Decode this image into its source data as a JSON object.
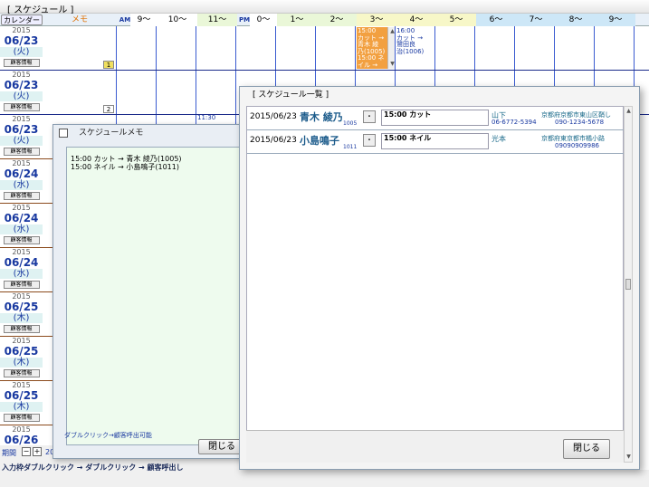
{
  "window_title": "[ スケジュール ]",
  "header": {
    "calendar_button": "カレンダー",
    "memo": "メモ",
    "am": "AM",
    "pm": "PM",
    "hours": [
      {
        "label": "9〜",
        "color": "#ffffff"
      },
      {
        "label": "10〜",
        "color": "#ffffff"
      },
      {
        "label": "11〜",
        "color": "#eaf7d8"
      },
      {
        "label": "0〜",
        "color": "#ffffff"
      },
      {
        "label": "1〜",
        "color": "#eaf7d8"
      },
      {
        "label": "2〜",
        "color": "#eaf7d8"
      },
      {
        "label": "3〜",
        "color": "#f7f7c8"
      },
      {
        "label": "4〜",
        "color": "#f7f7c8"
      },
      {
        "label": "5〜",
        "color": "#f7f7c8"
      },
      {
        "label": "6〜",
        "color": "#cde7f7"
      },
      {
        "label": "7〜",
        "color": "#cde7f7"
      },
      {
        "label": "8〜",
        "color": "#cde7f7"
      },
      {
        "label": "9〜",
        "color": "#cde7f7"
      }
    ]
  },
  "days": [
    {
      "year": "2015",
      "md": "06/23",
      "wd": "(火)",
      "sb": "顧客情報",
      "badge": "1"
    },
    {
      "year": "2015",
      "md": "06/23",
      "wd": "(火)",
      "sb": "顧客情報",
      "badge": "2"
    },
    {
      "year": "2015",
      "md": "06/23",
      "wd": "(火)",
      "sb": "顧客情報"
    },
    {
      "year": "2015",
      "md": "06/24",
      "wd": "(水)",
      "sb": "顧客情報"
    },
    {
      "year": "2015",
      "md": "06/24",
      "wd": "(水)",
      "sb": "顧客情報"
    },
    {
      "year": "2015",
      "md": "06/24",
      "wd": "(水)",
      "sb": "顧客情報"
    },
    {
      "year": "2015",
      "md": "06/25",
      "wd": "(木)",
      "sb": "顧客情報"
    },
    {
      "year": "2015",
      "md": "06/25",
      "wd": "(木)",
      "sb": "顧客情報"
    },
    {
      "year": "2015",
      "md": "06/25",
      "wd": "(木)",
      "sb": "顧客情報"
    },
    {
      "year": "2015",
      "md": "06/26",
      "wd": "",
      "sb": ""
    }
  ],
  "grid_appts": {
    "a1": "15:00\nカット →\n青木 綾\n乃(1005)\n15:00 ネ\nイル →",
    "a2": "16:00\nカット →\n鷲田良\n治(1006)",
    "time_label": "11:30"
  },
  "bottom": {
    "period_label": "期間",
    "hint": "入力枠ダブルクリック → ダブルクリック → 顧客呼出し",
    "partial": "20"
  },
  "memo_window": {
    "title": "スケジュールメモ",
    "lines": [
      "15:00 カット → 青木 綾乃(1005)",
      "15:00 ネイル → 小島鳴子(1011)"
    ],
    "hint": "ダブルクリック→顧客呼出可能",
    "close": "閉じる"
  },
  "list_window": {
    "title": "[ スケジュール一覧 ]",
    "close": "閉じる",
    "entries": [
      {
        "date": "2015/06/23",
        "name": "青木 綾乃",
        "id": "1005",
        "btn": "・",
        "appt": "15:00 カット",
        "staff": "山下",
        "tel1": "06-6772-5394",
        "addr": "京都府京都市東山区鞘し",
        "tel2": "090-1234-5678"
      },
      {
        "date": "2015/06/23",
        "name": "小島鳴子",
        "id": "1011",
        "btn": "・",
        "appt": "15:00 ネイル",
        "staff": "光本",
        "tel1": "",
        "addr": "京都府東京都市橘小路",
        "tel2": "09090909986"
      }
    ]
  }
}
